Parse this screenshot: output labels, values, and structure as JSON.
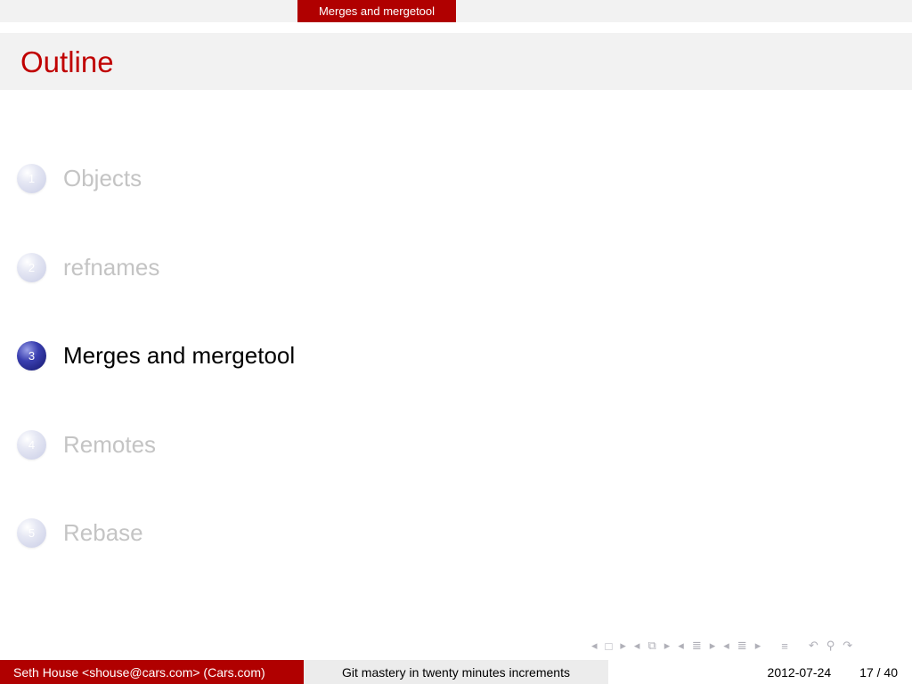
{
  "header": {
    "section": "Merges and mergetool"
  },
  "frame": {
    "title": "Outline"
  },
  "outline": {
    "items": [
      {
        "number": "1",
        "label": "Objects",
        "active": false
      },
      {
        "number": "2",
        "label": "refnames",
        "active": false
      },
      {
        "number": "3",
        "label": "Merges and mergetool",
        "active": true
      },
      {
        "number": "4",
        "label": "Remotes",
        "active": false
      },
      {
        "number": "5",
        "label": "Rebase",
        "active": false
      }
    ]
  },
  "footer": {
    "author": "Seth House <shouse@cars.com> (Cars.com)",
    "talk_title": "Git mastery in twenty minutes increments",
    "date": "2012-07-24",
    "page": "17 / 40"
  },
  "colors": {
    "accent": "#b00000",
    "title": "#c00000",
    "active_ball": "#2a2e9e"
  },
  "nav_icons": [
    "prev-frame-icon",
    "frame-icon",
    "next-frame-icon",
    "prev-subsection-icon",
    "subsection-icon",
    "next-subsection-icon",
    "prev-section-icon",
    "section-icon",
    "next-section-icon",
    "prev-part-icon",
    "part-icon",
    "next-part-icon",
    "align-icon",
    "back-icon",
    "search-icon",
    "forward-icon"
  ]
}
